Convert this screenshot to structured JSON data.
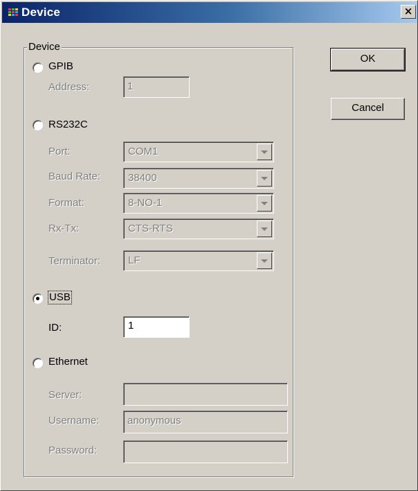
{
  "window": {
    "title": "Device",
    "close_glyph": "×"
  },
  "group": {
    "title": "Device"
  },
  "options": {
    "gpib": {
      "label": "GPIB",
      "address_label": "Address:",
      "address_value": "1",
      "selected": false
    },
    "rs232c": {
      "label": "RS232C",
      "selected": false,
      "port_label": "Port:",
      "port_value": "COM1",
      "baud_label": "Baud Rate:",
      "baud_value": "38400",
      "format_label": "Format:",
      "format_value": "8-NO-1",
      "rxtx_label": "Rx-Tx:",
      "rxtx_value": "CTS-RTS",
      "terminator_label": "Terminator:",
      "terminator_value": "LF"
    },
    "usb": {
      "label": "USB",
      "id_label": "ID:",
      "id_value": "1",
      "selected": true
    },
    "ethernet": {
      "label": "Ethernet",
      "selected": false,
      "server_label": "Server:",
      "server_value": "",
      "username_label": "Username:",
      "username_value": "anonymous",
      "password_label": "Password:",
      "password_value": ""
    }
  },
  "buttons": {
    "ok": "OK",
    "cancel": "Cancel"
  },
  "icons": {
    "app": "app-icon",
    "dropdown": "chevron-down-icon",
    "close": "close-icon"
  }
}
